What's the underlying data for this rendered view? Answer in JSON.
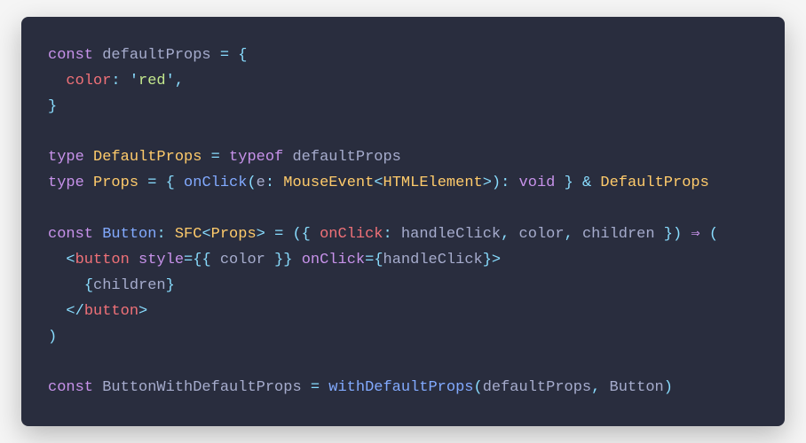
{
  "code": {
    "lines": [
      {
        "spans": [
          {
            "cls": "kw-decl",
            "t": "const"
          },
          {
            "cls": "ident",
            "t": " defaultProps "
          },
          {
            "cls": "punct",
            "t": "="
          },
          {
            "cls": "ident",
            "t": " "
          },
          {
            "cls": "punct",
            "t": "{"
          }
        ]
      },
      {
        "spans": [
          {
            "cls": "ident",
            "t": "  "
          },
          {
            "cls": "prop",
            "t": "color"
          },
          {
            "cls": "punct",
            "t": ":"
          },
          {
            "cls": "ident",
            "t": " "
          },
          {
            "cls": "punct",
            "t": "'"
          },
          {
            "cls": "str",
            "t": "red"
          },
          {
            "cls": "punct",
            "t": "',"
          }
        ]
      },
      {
        "spans": [
          {
            "cls": "punct",
            "t": "}"
          }
        ]
      },
      {
        "spans": [
          {
            "cls": "ident",
            "t": " "
          }
        ]
      },
      {
        "spans": [
          {
            "cls": "kw-decl",
            "t": "type"
          },
          {
            "cls": "ident",
            "t": " "
          },
          {
            "cls": "kw-type",
            "t": "DefaultProps"
          },
          {
            "cls": "ident",
            "t": " "
          },
          {
            "cls": "punct",
            "t": "="
          },
          {
            "cls": "ident",
            "t": " "
          },
          {
            "cls": "kw-decl",
            "t": "typeof"
          },
          {
            "cls": "ident",
            "t": " defaultProps"
          }
        ]
      },
      {
        "spans": [
          {
            "cls": "kw-decl",
            "t": "type"
          },
          {
            "cls": "ident",
            "t": " "
          },
          {
            "cls": "kw-type",
            "t": "Props"
          },
          {
            "cls": "ident",
            "t": " "
          },
          {
            "cls": "punct",
            "t": "="
          },
          {
            "cls": "ident",
            "t": " "
          },
          {
            "cls": "punct",
            "t": "{"
          },
          {
            "cls": "ident",
            "t": " "
          },
          {
            "cls": "func",
            "t": "onClick"
          },
          {
            "cls": "punct",
            "t": "("
          },
          {
            "cls": "ident",
            "t": "e"
          },
          {
            "cls": "punct",
            "t": ":"
          },
          {
            "cls": "ident",
            "t": " "
          },
          {
            "cls": "kw-type",
            "t": "MouseEvent"
          },
          {
            "cls": "punct",
            "t": "<"
          },
          {
            "cls": "kw-type",
            "t": "HTMLElement"
          },
          {
            "cls": "punct",
            "t": ">):"
          },
          {
            "cls": "ident",
            "t": " "
          },
          {
            "cls": "void",
            "t": "void"
          },
          {
            "cls": "ident",
            "t": " "
          },
          {
            "cls": "punct",
            "t": "}"
          },
          {
            "cls": "ident",
            "t": " "
          },
          {
            "cls": "punct",
            "t": "&"
          },
          {
            "cls": "ident",
            "t": " "
          },
          {
            "cls": "kw-type",
            "t": "DefaultProps"
          }
        ]
      },
      {
        "spans": [
          {
            "cls": "ident",
            "t": " "
          }
        ]
      },
      {
        "spans": [
          {
            "cls": "kw-decl",
            "t": "const"
          },
          {
            "cls": "ident",
            "t": " "
          },
          {
            "cls": "func",
            "t": "Button"
          },
          {
            "cls": "punct",
            "t": ":"
          },
          {
            "cls": "ident",
            "t": " "
          },
          {
            "cls": "kw-type",
            "t": "SFC"
          },
          {
            "cls": "punct",
            "t": "<"
          },
          {
            "cls": "kw-type",
            "t": "Props"
          },
          {
            "cls": "punct",
            "t": ">"
          },
          {
            "cls": "ident",
            "t": " "
          },
          {
            "cls": "punct",
            "t": "="
          },
          {
            "cls": "ident",
            "t": " "
          },
          {
            "cls": "punct",
            "t": "({"
          },
          {
            "cls": "ident",
            "t": " "
          },
          {
            "cls": "prop",
            "t": "onClick"
          },
          {
            "cls": "punct",
            "t": ":"
          },
          {
            "cls": "ident",
            "t": " handleClick"
          },
          {
            "cls": "punct",
            "t": ","
          },
          {
            "cls": "ident",
            "t": " color"
          },
          {
            "cls": "punct",
            "t": ","
          },
          {
            "cls": "ident",
            "t": " children "
          },
          {
            "cls": "punct",
            "t": "})"
          },
          {
            "cls": "ident",
            "t": " "
          },
          {
            "cls": "arrow",
            "t": "⇒"
          },
          {
            "cls": "ident",
            "t": " "
          },
          {
            "cls": "punct",
            "t": "("
          }
        ]
      },
      {
        "spans": [
          {
            "cls": "ident",
            "t": "  "
          },
          {
            "cls": "punct",
            "t": "<"
          },
          {
            "cls": "tag",
            "t": "button"
          },
          {
            "cls": "ident",
            "t": " "
          },
          {
            "cls": "attr",
            "t": "style"
          },
          {
            "cls": "punct",
            "t": "="
          },
          {
            "cls": "punct",
            "t": "{{"
          },
          {
            "cls": "ident",
            "t": " color "
          },
          {
            "cls": "punct",
            "t": "}}"
          },
          {
            "cls": "ident",
            "t": " "
          },
          {
            "cls": "attr",
            "t": "onClick"
          },
          {
            "cls": "punct",
            "t": "="
          },
          {
            "cls": "punct",
            "t": "{"
          },
          {
            "cls": "ident",
            "t": "handleClick"
          },
          {
            "cls": "punct",
            "t": "}>"
          }
        ]
      },
      {
        "spans": [
          {
            "cls": "ident",
            "t": "    "
          },
          {
            "cls": "punct",
            "t": "{"
          },
          {
            "cls": "ident",
            "t": "children"
          },
          {
            "cls": "punct",
            "t": "}"
          }
        ]
      },
      {
        "spans": [
          {
            "cls": "ident",
            "t": "  "
          },
          {
            "cls": "punct",
            "t": "</"
          },
          {
            "cls": "tag",
            "t": "button"
          },
          {
            "cls": "punct",
            "t": ">"
          }
        ]
      },
      {
        "spans": [
          {
            "cls": "punct",
            "t": ")"
          }
        ]
      },
      {
        "spans": [
          {
            "cls": "ident",
            "t": " "
          }
        ]
      },
      {
        "spans": [
          {
            "cls": "kw-decl",
            "t": "const"
          },
          {
            "cls": "ident",
            "t": " ButtonWithDefaultProps "
          },
          {
            "cls": "punct",
            "t": "="
          },
          {
            "cls": "ident",
            "t": " "
          },
          {
            "cls": "func",
            "t": "withDefaultProps"
          },
          {
            "cls": "punct",
            "t": "("
          },
          {
            "cls": "ident",
            "t": "defaultProps"
          },
          {
            "cls": "punct",
            "t": ","
          },
          {
            "cls": "ident",
            "t": " Button"
          },
          {
            "cls": "punct",
            "t": ")"
          }
        ]
      }
    ]
  }
}
